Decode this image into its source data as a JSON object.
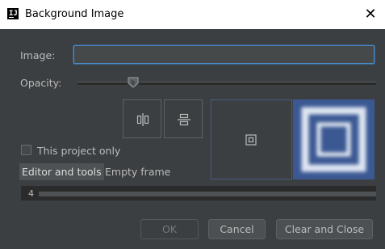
{
  "window": {
    "title": "Background Image",
    "app_icon": "intellij-icon",
    "close_glyph": "✕"
  },
  "form": {
    "image_label": "Image:",
    "image_value": "",
    "opacity_label": "Opacity:",
    "opacity_value": 0.18
  },
  "placement": {
    "buttons": [
      "align-horizontal-center-icon",
      "align-vertical-center-icon"
    ],
    "preview_icon": "frame-center-icon"
  },
  "options": {
    "this_project_only_label": "This project only",
    "this_project_only_checked": false,
    "targets": [
      {
        "label": "Editor and tools",
        "selected": true
      },
      {
        "label": "Empty frame",
        "selected": false
      }
    ],
    "fill_value": "4"
  },
  "buttons": {
    "ok": "OK",
    "cancel": "Cancel",
    "clear_and_close": "Clear and Close"
  },
  "colors": {
    "background": "#3c3f41",
    "accent": "#4a88c7",
    "preview_bg": "#3b5893"
  }
}
